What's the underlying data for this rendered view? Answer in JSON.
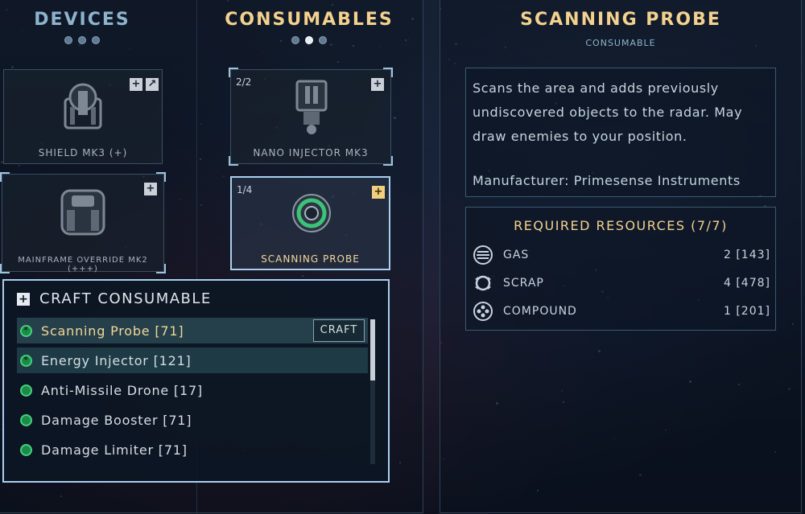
{
  "devices": {
    "title": "DEVICES",
    "cards": [
      {
        "label": "SHIELD MK3 (+)"
      },
      {
        "label": "MAINFRAME OVERRIDE MK2 (+++)"
      }
    ]
  },
  "consumables": {
    "title": "CONSUMABLES",
    "cards": [
      {
        "label": "NANO INJECTOR MK3",
        "count": "2/2"
      },
      {
        "label": "SCANNING PROBE",
        "count": "1/4"
      }
    ]
  },
  "craft": {
    "title": "CRAFT CONSUMABLE",
    "button_label": "CRAFT",
    "items": [
      {
        "label": "Scanning Probe [71]",
        "state": "selected"
      },
      {
        "label": "Energy Injector [121]",
        "state": "highlight"
      },
      {
        "label": "Anti-Missile Drone [17]",
        "state": "normal"
      },
      {
        "label": "Damage Booster [71]",
        "state": "normal"
      },
      {
        "label": "Damage Limiter [71]",
        "state": "normal"
      }
    ]
  },
  "detail": {
    "title": "SCANNING PROBE",
    "subtitle": "CONSUMABLE",
    "description": "Scans the area and adds previously undiscovered objects to the radar. May draw enemies to your position.",
    "manufacturer": "Manufacturer: Primesense Instruments",
    "resources_title": "REQUIRED RESOURCES (7/7)",
    "resources": [
      {
        "name": "GAS",
        "value": "2 [143]",
        "icon": "gas-icon"
      },
      {
        "name": "SCRAP",
        "value": "4 [478]",
        "icon": "scrap-icon"
      },
      {
        "name": "COMPOUND",
        "value": "1 [201]",
        "icon": "compound-icon"
      }
    ]
  },
  "colors": {
    "accent_gold": "#f3d18e",
    "accent_blue": "#8db4cc",
    "status_green": "#44d27d"
  }
}
